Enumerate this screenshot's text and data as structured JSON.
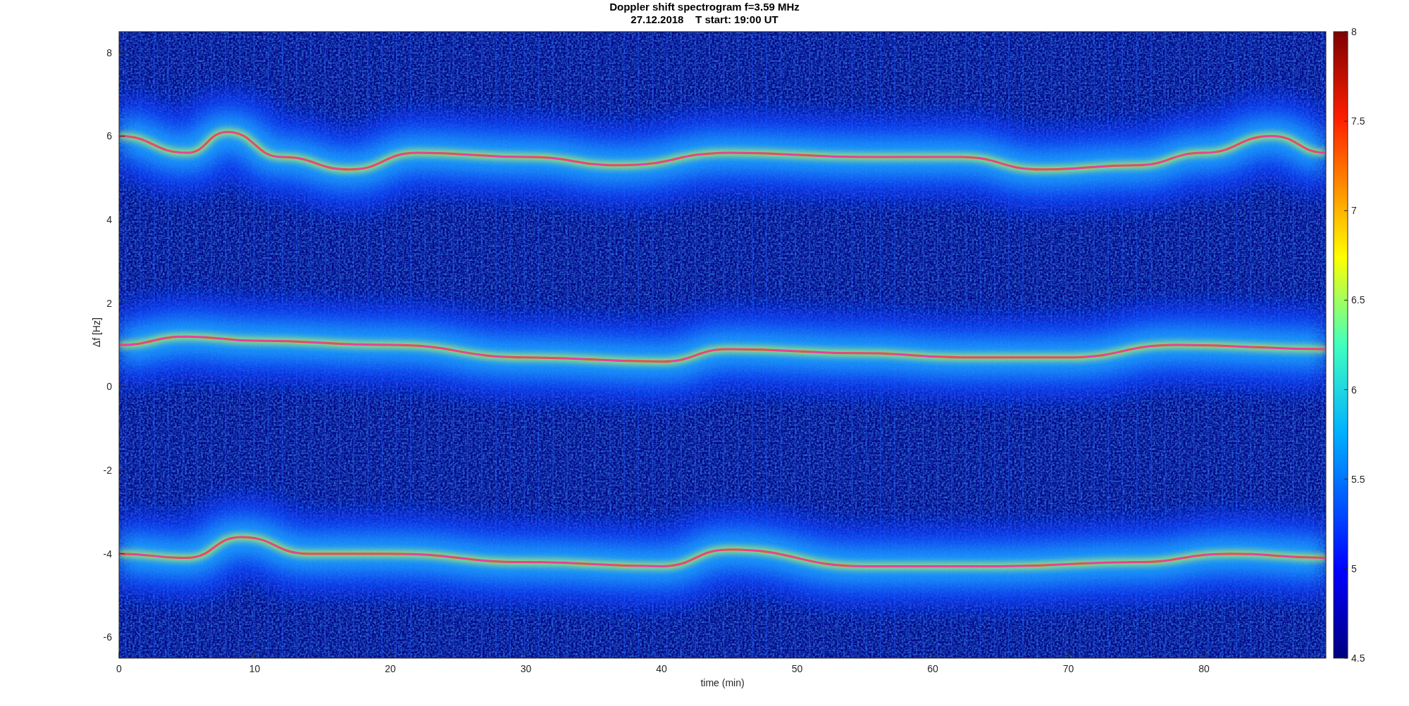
{
  "figure": {
    "title_lines": [
      "Doppler shift spectrogram f=3.59 MHz",
      "27.12.2018    T start: 19:00 UT"
    ],
    "ylabel": "Δf [Hz]",
    "xlabel": "time (min)",
    "yticks": [
      "8",
      "6",
      "4",
      "2",
      "0",
      "-2",
      "-4",
      "-6"
    ],
    "xticks": [
      "0",
      "10",
      "20",
      "30",
      "40",
      "50",
      "60",
      "70",
      "80"
    ],
    "colorbar_ticks": [
      "8",
      "7.5",
      "7",
      "6.5",
      "6",
      "5.5",
      "5",
      "4.5"
    ]
  }
}
